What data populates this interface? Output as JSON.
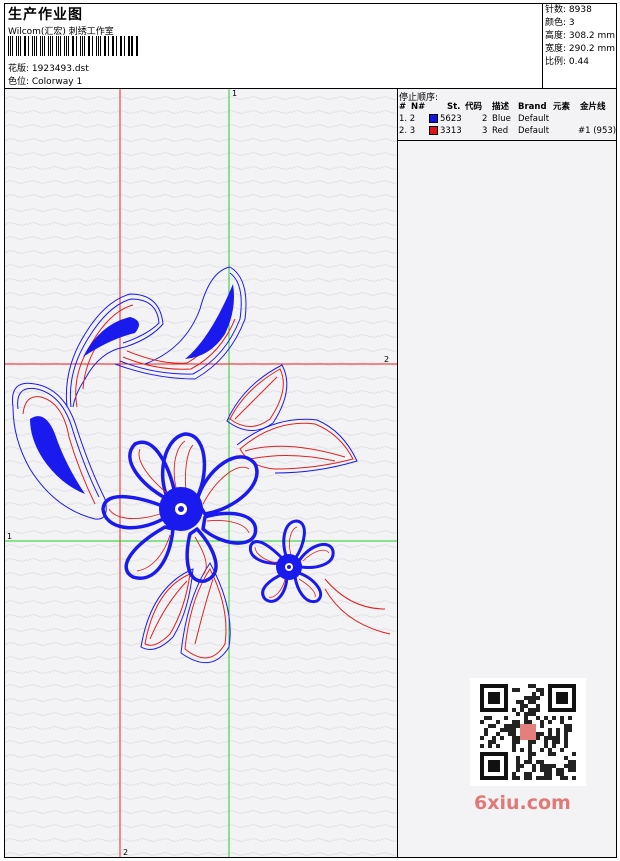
{
  "header": {
    "title": "生产作业图",
    "subtitle": "Wilcom(汇宏) 刺绣工作室",
    "design_label": "花版: 1923493.dst",
    "colorway_label": "色位: Colorway 1"
  },
  "stats": [
    {
      "label": "针数: 8938"
    },
    {
      "label": "颜色: 3"
    },
    {
      "label": "高度: 308.2 mm"
    },
    {
      "label": "宽度: 290.2 mm"
    },
    {
      "label": "比例: 0.44"
    }
  ],
  "stop_sequence": {
    "title": "停止顺序:",
    "columns": [
      "#",
      "N#",
      "St.",
      "代码",
      "描述",
      "Brand",
      "元素",
      "金片线"
    ],
    "rows": [
      {
        "idx": "1. 2",
        "code_num": "5623",
        "st": "2",
        "desc": "Blue",
        "brand": "Default",
        "element": "",
        "color": "#1414e0"
      },
      {
        "idx": "2. 3",
        "code_num": "3313",
        "st": "3",
        "desc": "Red",
        "brand": "Default",
        "element": "#1 (953)",
        "color": "#e01414"
      }
    ]
  },
  "guides": {
    "v1_label": "1",
    "h2_label": "2",
    "h1_label": "1",
    "v2_label": "2"
  },
  "watermark": {
    "brand_text": "6xiu.com"
  },
  "colors": {
    "thread_blue": "#1a1aee",
    "thread_red": "#dd2222",
    "guide_green": "#22cc22",
    "guide_red": "#ee2222"
  }
}
